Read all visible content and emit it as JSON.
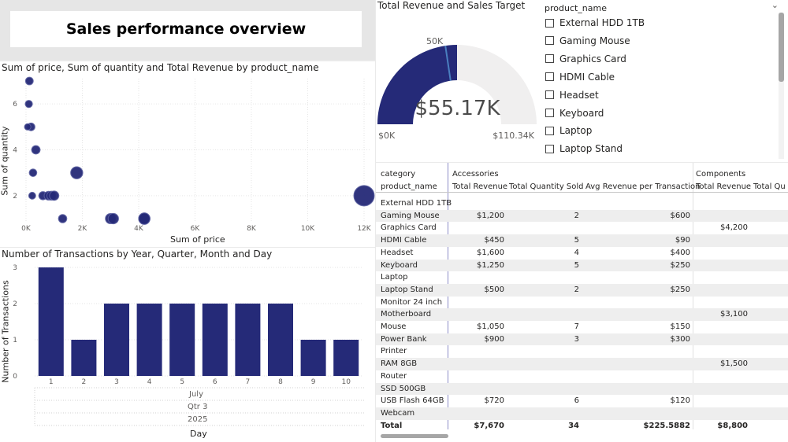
{
  "report_title": "Sales performance overview",
  "scatter": {
    "title": "Sum of price, Sum of quantity and Total Revenue by product_name",
    "x_label": "Sum of price",
    "y_label": "Sum of quantity",
    "x_ticks": [
      "0K",
      "2K",
      "4K",
      "6K",
      "8K",
      "10K",
      "12K"
    ],
    "y_ticks": [
      "2",
      "4",
      "6"
    ]
  },
  "bar_chart": {
    "title": "Number of Transactions by Year, Quarter, Month and Day",
    "y_label": "Number of Transactions",
    "x_label": "Day",
    "month": "July",
    "quarter": "Qtr 3",
    "year": "2025",
    "y_ticks": [
      "0",
      "1",
      "2",
      "3"
    ]
  },
  "gauge": {
    "title": "Total Revenue and Sales Target",
    "value_label": "$55.17K",
    "min_label": "$0K",
    "max_label": "$110.34K",
    "target_label": "50K",
    "colors": {
      "fill": "#252a78",
      "track": "#f0efef",
      "target": "#4a7fc0"
    }
  },
  "slicer": {
    "header": "product_name",
    "items": [
      "External HDD 1TB",
      "Gaming Mouse",
      "Graphics Card",
      "HDMI Cable",
      "Headset",
      "Keyboard",
      "Laptop",
      "Laptop Stand"
    ]
  },
  "table": {
    "hdr_category": "category",
    "hdr_product": "product_name",
    "group1": "Accessories",
    "group2": "Components",
    "col_total_revenue": "Total Revenue",
    "col_total_qty": "Total Quantity Sold",
    "col_avg": "Avg Revenue per Transaction",
    "col_total_revenue_2": "Total Revenue",
    "col_total_qty_2": "Total Qu",
    "rows": [
      {
        "name": "External HDD 1TB",
        "rev": "",
        "qty": "",
        "avg": "",
        "rev2": ""
      },
      {
        "name": "Gaming Mouse",
        "rev": "$1,200",
        "qty": "2",
        "avg": "$600",
        "rev2": ""
      },
      {
        "name": "Graphics Card",
        "rev": "",
        "qty": "",
        "avg": "",
        "rev2": "$4,200"
      },
      {
        "name": "HDMI Cable",
        "rev": "$450",
        "qty": "5",
        "avg": "$90",
        "rev2": ""
      },
      {
        "name": "Headset",
        "rev": "$1,600",
        "qty": "4",
        "avg": "$400",
        "rev2": ""
      },
      {
        "name": "Keyboard",
        "rev": "$1,250",
        "qty": "5",
        "avg": "$250",
        "rev2": ""
      },
      {
        "name": "Laptop",
        "rev": "",
        "qty": "",
        "avg": "",
        "rev2": ""
      },
      {
        "name": "Laptop Stand",
        "rev": "$500",
        "qty": "2",
        "avg": "$250",
        "rev2": ""
      },
      {
        "name": "Monitor 24 inch",
        "rev": "",
        "qty": "",
        "avg": "",
        "rev2": ""
      },
      {
        "name": "Motherboard",
        "rev": "",
        "qty": "",
        "avg": "",
        "rev2": "$3,100"
      },
      {
        "name": "Mouse",
        "rev": "$1,050",
        "qty": "7",
        "avg": "$150",
        "rev2": ""
      },
      {
        "name": "Power Bank",
        "rev": "$900",
        "qty": "3",
        "avg": "$300",
        "rev2": ""
      },
      {
        "name": "Printer",
        "rev": "",
        "qty": "",
        "avg": "",
        "rev2": ""
      },
      {
        "name": "RAM 8GB",
        "rev": "",
        "qty": "",
        "avg": "",
        "rev2": "$1,500"
      },
      {
        "name": "Router",
        "rev": "",
        "qty": "",
        "avg": "",
        "rev2": ""
      },
      {
        "name": "SSD 500GB",
        "rev": "",
        "qty": "",
        "avg": "",
        "rev2": ""
      },
      {
        "name": "USB Flash 64GB",
        "rev": "$720",
        "qty": "6",
        "avg": "$120",
        "rev2": ""
      },
      {
        "name": "Webcam",
        "rev": "",
        "qty": "",
        "avg": "",
        "rev2": ""
      }
    ],
    "total": {
      "name": "Total",
      "rev": "$7,670",
      "qty": "34",
      "avg": "$225.5882",
      "rev2": "$8,800"
    }
  },
  "chart_data": [
    {
      "type": "scatter",
      "title": "Sum of price, Sum of quantity and Total Revenue by product_name",
      "xlabel": "Sum of price",
      "ylabel": "Sum of quantity",
      "xlim": [
        0,
        12000
      ],
      "ylim": [
        1,
        7
      ],
      "x_ticks": [
        "0K",
        "2K",
        "4K",
        "6K",
        "8K",
        "10K",
        "12K"
      ],
      "y_ticks": [
        2,
        4,
        6
      ],
      "points": [
        {
          "x": 120,
          "y": 7,
          "size": 840
        },
        {
          "x": 100,
          "y": 6,
          "size": 600
        },
        {
          "x": 180,
          "y": 5,
          "size": 900
        },
        {
          "x": 60,
          "y": 5,
          "size": 300
        },
        {
          "x": 350,
          "y": 4,
          "size": 1400
        },
        {
          "x": 250,
          "y": 3,
          "size": 750
        },
        {
          "x": 220,
          "y": 2,
          "size": 440
        },
        {
          "x": 600,
          "y": 2,
          "size": 1200
        },
        {
          "x": 800,
          "y": 2,
          "size": 1600
        },
        {
          "x": 900,
          "y": 2,
          "size": 1800
        },
        {
          "x": 1000,
          "y": 2,
          "size": 2000
        },
        {
          "x": 1800,
          "y": 3,
          "size": 5400
        },
        {
          "x": 12000,
          "y": 2,
          "size": 24000
        },
        {
          "x": 1300,
          "y": 1,
          "size": 1300
        },
        {
          "x": 3000,
          "y": 1,
          "size": 3000
        },
        {
          "x": 3100,
          "y": 1,
          "size": 3100
        },
        {
          "x": 4200,
          "y": 1,
          "size": 4200
        },
        {
          "x": 4200,
          "y": 1,
          "size": 4200
        }
      ]
    },
    {
      "type": "bar",
      "title": "Number of Transactions by Year, Quarter, Month and Day",
      "xlabel": "Day",
      "ylabel": "Number of Transactions",
      "categories": [
        "1",
        "2",
        "3",
        "4",
        "5",
        "6",
        "7",
        "8",
        "9",
        "10"
      ],
      "values": [
        3,
        1,
        2,
        2,
        2,
        2,
        2,
        2,
        1,
        1
      ],
      "ylim": [
        0,
        3
      ],
      "color": "#252a78"
    },
    {
      "type": "gauge",
      "title": "Total Revenue and Sales Target",
      "value": 55170,
      "min": 0,
      "max": 110340,
      "target": 50000
    }
  ]
}
